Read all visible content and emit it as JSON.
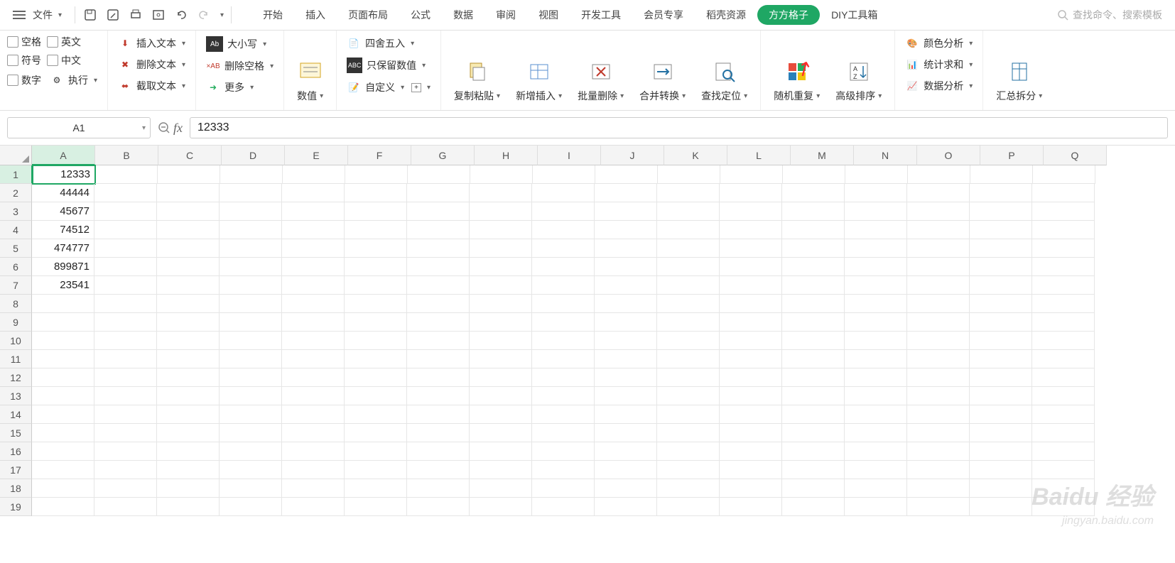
{
  "topbar": {
    "file_label": "文件",
    "tabs": [
      "开始",
      "插入",
      "页面布局",
      "公式",
      "数据",
      "审阅",
      "视图",
      "开发工具",
      "会员专享",
      "稻壳资源",
      "方方格子",
      "DIY工具箱"
    ],
    "active_tab_index": 10,
    "search_placeholder": "查找命令、搜索模板"
  },
  "ribbon": {
    "checks": {
      "space": "空格",
      "english": "英文",
      "symbol": "符号",
      "chinese": "中文",
      "number": "数字",
      "execute": "执行"
    },
    "text_group": {
      "insert_text": "插入文本",
      "delete_text": "删除文本",
      "extract_text": "截取文本"
    },
    "case_group": {
      "case": "大小写",
      "delete_space": "删除空格",
      "more": "更多"
    },
    "numeric": "数值",
    "num_group": {
      "round": "四舍五入",
      "keep_number": "只保留数值",
      "custom": "自定义"
    },
    "big_buttons": {
      "copy_paste": "复制粘贴",
      "new_insert": "新增插入",
      "bulk_delete": "批量删除",
      "merge_convert": "合并转换",
      "find_locate": "查找定位",
      "random_repeat": "随机重复",
      "advanced_sort": "高级排序",
      "summary_split": "汇总拆分"
    },
    "analysis": {
      "color": "颜色分析",
      "stat": "统计求和",
      "data": "数据分析"
    }
  },
  "formula_bar": {
    "cell_ref": "A1",
    "formula": "12333"
  },
  "columns": [
    "A",
    "B",
    "C",
    "D",
    "E",
    "F",
    "G",
    "H",
    "I",
    "J",
    "K",
    "L",
    "M",
    "N",
    "O",
    "P",
    "Q"
  ],
  "row_numbers": [
    1,
    2,
    3,
    4,
    5,
    6,
    7,
    8,
    9,
    10,
    11,
    12,
    13,
    14,
    15,
    16,
    17,
    18,
    19
  ],
  "cells": {
    "A1": "12333",
    "A2": "44444",
    "A3": "45677",
    "A4": "74512",
    "A5": "474777",
    "A6": "899871",
    "A7": "23541"
  },
  "active_cell": "A1",
  "selected_col": "A",
  "selected_row": 1,
  "watermark": {
    "main": "Baidu 经验",
    "sub": "jingyan.baidu.com"
  }
}
